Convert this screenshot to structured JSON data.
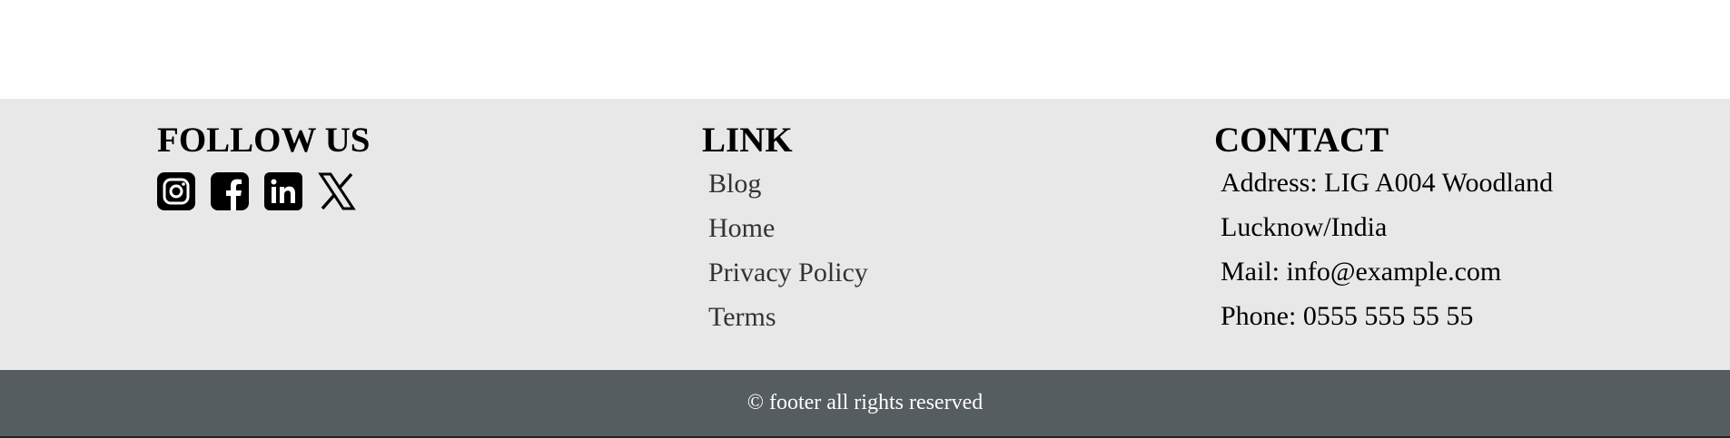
{
  "follow": {
    "title": "FOLLOW US",
    "icons": [
      "instagram-icon",
      "facebook-icon",
      "linkedin-icon",
      "x-twitter-icon"
    ]
  },
  "links": {
    "title": "LINK",
    "items": [
      "Blog",
      "Home",
      "Privacy Policy",
      "Terms"
    ]
  },
  "contact": {
    "title": "CONTACT",
    "address_line1": "Address: LIG A004 Woodland",
    "address_line2": "Lucknow/India",
    "mail": "Mail: info@example.com",
    "phone": "Phone: 0555 555 55 55"
  },
  "copyright": "© footer all rights reserved",
  "colors": {
    "footer_bg": "#e8e8e8",
    "bottom_bar_bg": "#565d60",
    "text": "#000000",
    "link_text": "#333333"
  }
}
